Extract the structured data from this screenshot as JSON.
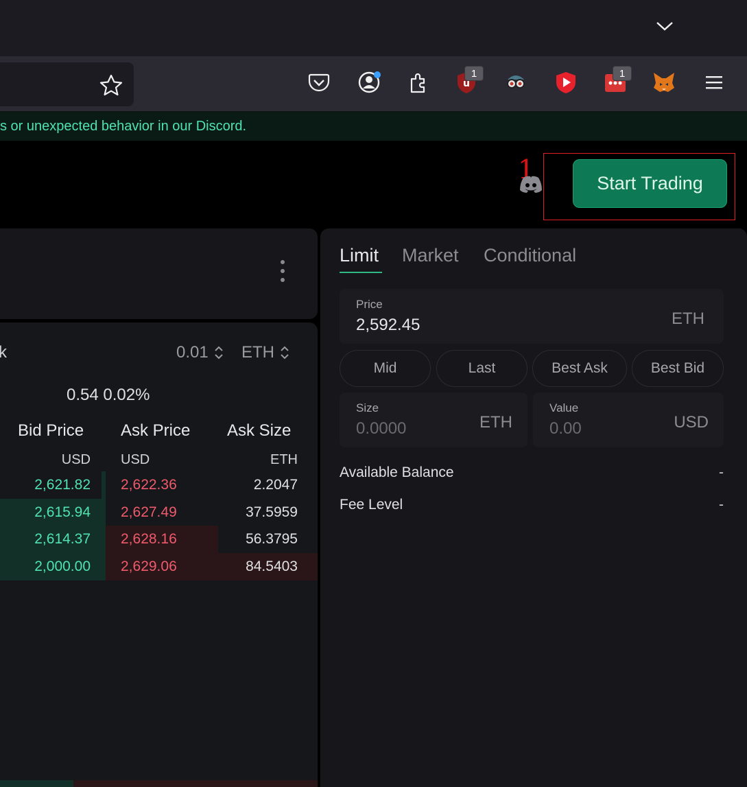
{
  "browser": {
    "extension_badges": {
      "ublock": "1",
      "passwords": "1"
    }
  },
  "notice": {
    "text": "s or unexpected behavior in our Discord."
  },
  "header": {
    "annotation_number": "1",
    "start_trading_label": "Start Trading"
  },
  "orderbook": {
    "partial_title": "k",
    "tick_size": "0.01",
    "tick_unit": "ETH",
    "spread": "0.54 0.02%",
    "columns": [
      {
        "label": "Bid Price",
        "unit": "USD"
      },
      {
        "label": "Ask Price",
        "unit": "USD"
      },
      {
        "label": "Ask Size",
        "unit": "ETH"
      }
    ],
    "rows": [
      {
        "bid": "2,621.82",
        "ask": "2,622.36",
        "ask_size": "2.2047"
      },
      {
        "bid": "2,615.94",
        "ask": "2,627.49",
        "ask_size": "37.5959"
      },
      {
        "bid": "2,614.37",
        "ask": "2,628.16",
        "ask_size": "56.3795"
      },
      {
        "bid": "2,000.00",
        "ask": "2,629.06",
        "ask_size": "84.5403"
      }
    ]
  },
  "trade": {
    "tabs": [
      "Limit",
      "Market",
      "Conditional"
    ],
    "price": {
      "label": "Price",
      "value": "2,592.45",
      "unit": "ETH"
    },
    "quick_buttons": [
      "Mid",
      "Last",
      "Best Ask",
      "Best Bid"
    ],
    "size": {
      "label": "Size",
      "placeholder": "0.0000",
      "unit": "ETH"
    },
    "value": {
      "label": "Value",
      "placeholder": "0.00",
      "unit": "USD"
    },
    "available_balance": {
      "label": "Available Balance",
      "value": "-"
    },
    "fee_level": {
      "label": "Fee Level",
      "value": "-"
    }
  },
  "colors": {
    "bid": "#4fe3b0",
    "ask": "#f05a6c",
    "accent": "#0e7a55",
    "annotation": "#e01010"
  }
}
